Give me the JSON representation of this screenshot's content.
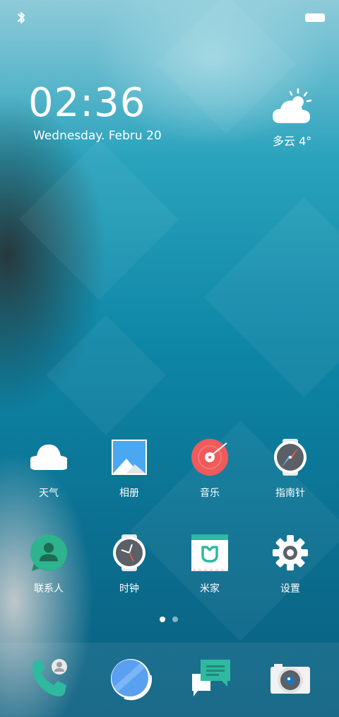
{
  "status_bar": {
    "bluetooth_icon": "bluetooth-icon",
    "battery_icon": "battery-icon"
  },
  "clock": {
    "time": "02:36",
    "date": "Wednesday.  Febru 20"
  },
  "weather": {
    "icon": "partly-cloudy-icon",
    "text": "多云 4°"
  },
  "apps": [
    {
      "label": "天气",
      "icon": "weather-cloud-icon"
    },
    {
      "label": "相册",
      "icon": "gallery-icon"
    },
    {
      "label": "音乐",
      "icon": "music-disc-icon"
    },
    {
      "label": "指南针",
      "icon": "compass-icon"
    },
    {
      "label": "联系人",
      "icon": "contacts-icon"
    },
    {
      "label": "时钟",
      "icon": "clock-icon"
    },
    {
      "label": "米家",
      "icon": "mijia-icon"
    },
    {
      "label": "设置",
      "icon": "settings-gear-icon"
    }
  ],
  "page_indicator": {
    "count": 2,
    "active_index": 0
  },
  "dock": [
    {
      "icon": "phone-icon"
    },
    {
      "icon": "browser-icon"
    },
    {
      "icon": "messages-icon"
    },
    {
      "icon": "camera-icon"
    }
  ],
  "colors": {
    "music": "#f05a5a",
    "contacts": "#2fb38f",
    "mijia": "#2fb9a0",
    "dock_phone": "#2fb9a0",
    "dock_messages": "#2fb9a0",
    "browser": "#5aa0f0",
    "gallery": "#4aa8f0"
  }
}
